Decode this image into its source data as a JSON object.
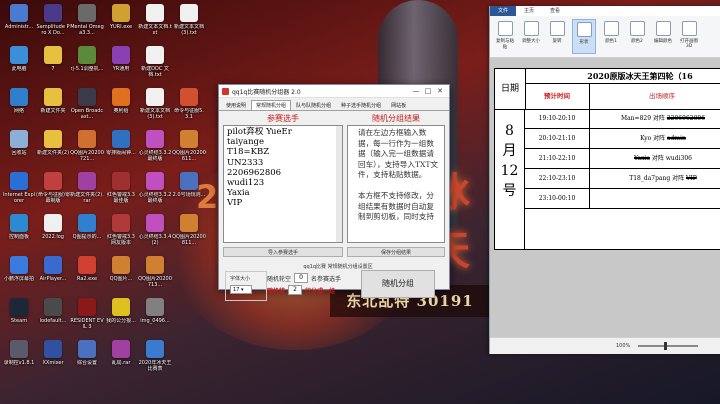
{
  "desktop": {
    "icons": [
      {
        "label": "Administr...",
        "color": "#4a7bd0",
        "col": 0,
        "row": 0
      },
      {
        "label": "此电脑",
        "color": "#3b8fd8",
        "col": 0,
        "row": 1
      },
      {
        "label": "网络",
        "color": "#2f7fcf",
        "col": 0,
        "row": 2
      },
      {
        "label": "回收站",
        "color": "#8ab0d8",
        "col": 0,
        "row": 3
      },
      {
        "label": "Internet Explorer",
        "color": "#2a6fd8",
        "col": 0,
        "row": 4
      },
      {
        "label": "控制面板",
        "color": "#2c8ad0",
        "col": 0,
        "row": 5
      },
      {
        "label": "小鹏浮屏幕拍",
        "color": "#3a7be0",
        "col": 0,
        "row": 6
      },
      {
        "label": "Steam",
        "color": "#1b2838",
        "col": 0,
        "row": 7
      },
      {
        "label": "录制控v1.8.1",
        "color": "#5a5a6a",
        "col": 0,
        "row": 8
      },
      {
        "label": "Samplitude Pro X Do...",
        "color": "#4a3a8a",
        "col": 1,
        "row": 0
      },
      {
        "label": "7",
        "color": "#e8c040",
        "col": 1,
        "row": 1
      },
      {
        "label": "新建文件夹",
        "color": "#e8c040",
        "col": 1,
        "row": 2
      },
      {
        "label": "新建文件夹(2)",
        "color": "#e8c040",
        "col": 1,
        "row": 3
      },
      {
        "label": "(命令与征服)零幕制版",
        "color": "#c04040",
        "col": 1,
        "row": 4
      },
      {
        "label": "2022.log",
        "color": "#f0f0f0",
        "col": 1,
        "row": 5
      },
      {
        "label": "AirPlayer...",
        "color": "#3a6ad0",
        "col": 1,
        "row": 6
      },
      {
        "label": "lodefault...",
        "color": "#4a4a4a",
        "col": 1,
        "row": 7
      },
      {
        "label": "XXmixer",
        "color": "#3050a0",
        "col": 1,
        "row": 8
      },
      {
        "label": "Mental Omega3.3...",
        "color": "#6a6a6a",
        "col": 2,
        "row": 0
      },
      {
        "label": "rj-5.1调整机...",
        "color": "#5a8a3a",
        "col": 2,
        "row": 1
      },
      {
        "label": "Open Broadcast...",
        "color": "#3a3a4a",
        "col": 2,
        "row": 2
      },
      {
        "label": "QQ图片20200721...",
        "color": "#d07030",
        "col": 2,
        "row": 3
      },
      {
        "label": "新建文件夹(2).rar",
        "color": "#a040a0",
        "col": 2,
        "row": 4
      },
      {
        "label": "Q图提示的...",
        "color": "#3080d0",
        "col": 2,
        "row": 5
      },
      {
        "label": "Ra2.exe",
        "color": "#d04030",
        "col": 2,
        "row": 6
      },
      {
        "label": "RESIDENT EVIL 3",
        "color": "#8a1a1a",
        "col": 2,
        "row": 7
      },
      {
        "label": "综合设置",
        "color": "#4a70c0",
        "col": 2,
        "row": 8
      },
      {
        "label": "YURI.exe",
        "color": "#d0a030",
        "col": 3,
        "row": 0
      },
      {
        "label": "YR通用",
        "color": "#8a40b0",
        "col": 3,
        "row": 1
      },
      {
        "label": "奥利给",
        "color": "#e07020",
        "col": 3,
        "row": 2
      },
      {
        "label": "零排版闹钟...",
        "color": "#3070c0",
        "col": 3,
        "row": 3
      },
      {
        "label": "红色警戒3.3 最佳版",
        "color": "#a03030",
        "col": 3,
        "row": 4
      },
      {
        "label": "红色警戒3.3 网友版本",
        "color": "#b03a3a",
        "col": 3,
        "row": 5
      },
      {
        "label": "QQ图片...",
        "color": "#d08030",
        "col": 3,
        "row": 6
      },
      {
        "label": "我的公分报...",
        "color": "#e0c020",
        "col": 3,
        "row": 7
      },
      {
        "label": "乱局.rar",
        "color": "#a040a0",
        "col": 3,
        "row": 8
      },
      {
        "label": "新建文本文档.txt",
        "color": "#f0f0f0",
        "col": 4,
        "row": 0
      },
      {
        "label": "新建DOC 文档.txt",
        "color": "#f0f0f0",
        "col": 4,
        "row": 1
      },
      {
        "label": "新建文本文档(3).txt",
        "color": "#f0f0f0",
        "col": 4,
        "row": 2
      },
      {
        "label": "心灵终结3.3.2最终版",
        "color": "#c050c0",
        "col": 4,
        "row": 3
      },
      {
        "label": "心灵终结3.3.2最终版",
        "color": "#c050c0",
        "col": 4,
        "row": 4
      },
      {
        "label": "心灵终结3.3.4(2)",
        "color": "#c050c0",
        "col": 4,
        "row": 5
      },
      {
        "label": "QQ图片20200713...",
        "color": "#d08030",
        "col": 4,
        "row": 6
      },
      {
        "label": "img_0496...",
        "color": "#808080",
        "col": 4,
        "row": 7
      },
      {
        "label": "2020年冰天王比赛表",
        "color": "#3a7bd0",
        "col": 4,
        "row": 8
      },
      {
        "label": "新建文本文档(3).txt",
        "color": "#f0f0f0",
        "col": 5,
        "row": 0
      },
      {
        "label": "命令与征服5.3.1",
        "color": "#d05030",
        "col": 5,
        "row": 2
      },
      {
        "label": "QQ图片20200611...",
        "color": "#d08030",
        "col": 5,
        "row": 3
      },
      {
        "label": "2.0号场规则...",
        "color": "#4a70c0",
        "col": 5,
        "row": 4
      },
      {
        "label": "QQ图片20200811...",
        "color": "#d08030",
        "col": 5,
        "row": 5
      }
    ],
    "wallpaper": {
      "banner": "东北乱特 30191",
      "big": "冰天",
      "big2": "20"
    }
  },
  "app": {
    "title": "qq1q比赛随机分组器 2.0",
    "tabs": [
      "使用说明",
      "常规随机分组",
      "队与队随机分组",
      "种子选手随机分组",
      "网站板"
    ],
    "active_tab": 1,
    "players_title": "参赛选手",
    "results_title": "随机分组结果",
    "players": [
      "pilot弃权 YueEr",
      "taiyange",
      "T18=KBZ",
      "UN2333",
      "2206962806",
      "wudi123",
      "Yaxia",
      "VIP"
    ],
    "results_text": "请在左边方框输入数据，每一行作为一组数据（输入完一组数据请回车），支持导入TXT文件，支持粘贴数据。\n\n本方框不支持修改，分组结果有数据时自动复制到剪切板，同时支持",
    "import_btn": "导入参赛选手",
    "export_btn": "保存分组结果",
    "hint": "qq1q比赛 常规随机分组设置区",
    "fontsize_label": "字体大小",
    "fontsize_value": "17",
    "random_blank_label": "随机轮空",
    "random_blank_value": "0",
    "random_blank_suffix": "名参赛选手",
    "random_seat_label": "随机将",
    "random_seat_value": "2",
    "random_seat_suffix": "行分成一组",
    "group_btn": "随机分组",
    "min": "—",
    "max": "□",
    "close": "✕"
  },
  "viewer": {
    "tabs": [
      "文件",
      "主页",
      "查看"
    ],
    "active_tab": 0,
    "tools": [
      "复制与粘贴",
      "调整大小",
      "旋转",
      "形状",
      "颜色1",
      "颜色2",
      "编辑颜色",
      "打开画图3D"
    ],
    "schedule": {
      "title": "2020原版冰天王第四轮（16",
      "date_head": "日期",
      "time_head": "预计时间",
      "order_head": "出场顺序",
      "date": [
        "8",
        "月",
        "12",
        "号"
      ],
      "rows": [
        {
          "time": "19:10-20:10",
          "match": "Man=829 对阵 ",
          "struck": "2206962806"
        },
        {
          "time": "20:10-21:10",
          "match": "Kyo 对阵 ",
          "struck": "admin"
        },
        {
          "time": "21:10-22:10",
          "match": "",
          "struck": "Yaxia",
          "after": " 对阵 wudi306"
        },
        {
          "time": "22:10-23:10",
          "match": "T18_da7pang 对阵 ",
          "struck": "VIP"
        },
        {
          "time": "23:10-00:10",
          "match": "",
          "struck": ""
        }
      ]
    },
    "zoom": "100%"
  }
}
